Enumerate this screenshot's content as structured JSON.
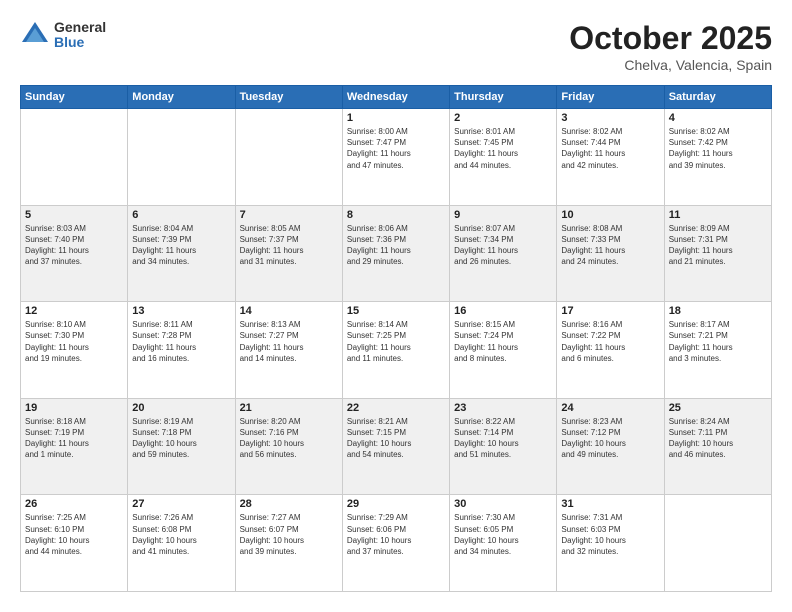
{
  "logo": {
    "general": "General",
    "blue": "Blue"
  },
  "title": "October 2025",
  "location": "Chelva, Valencia, Spain",
  "days_header": [
    "Sunday",
    "Monday",
    "Tuesday",
    "Wednesday",
    "Thursday",
    "Friday",
    "Saturday"
  ],
  "weeks": [
    [
      {
        "day": "",
        "info": ""
      },
      {
        "day": "",
        "info": ""
      },
      {
        "day": "",
        "info": ""
      },
      {
        "day": "1",
        "info": "Sunrise: 8:00 AM\nSunset: 7:47 PM\nDaylight: 11 hours\nand 47 minutes."
      },
      {
        "day": "2",
        "info": "Sunrise: 8:01 AM\nSunset: 7:45 PM\nDaylight: 11 hours\nand 44 minutes."
      },
      {
        "day": "3",
        "info": "Sunrise: 8:02 AM\nSunset: 7:44 PM\nDaylight: 11 hours\nand 42 minutes."
      },
      {
        "day": "4",
        "info": "Sunrise: 8:02 AM\nSunset: 7:42 PM\nDaylight: 11 hours\nand 39 minutes."
      }
    ],
    [
      {
        "day": "5",
        "info": "Sunrise: 8:03 AM\nSunset: 7:40 PM\nDaylight: 11 hours\nand 37 minutes."
      },
      {
        "day": "6",
        "info": "Sunrise: 8:04 AM\nSunset: 7:39 PM\nDaylight: 11 hours\nand 34 minutes."
      },
      {
        "day": "7",
        "info": "Sunrise: 8:05 AM\nSunset: 7:37 PM\nDaylight: 11 hours\nand 31 minutes."
      },
      {
        "day": "8",
        "info": "Sunrise: 8:06 AM\nSunset: 7:36 PM\nDaylight: 11 hours\nand 29 minutes."
      },
      {
        "day": "9",
        "info": "Sunrise: 8:07 AM\nSunset: 7:34 PM\nDaylight: 11 hours\nand 26 minutes."
      },
      {
        "day": "10",
        "info": "Sunrise: 8:08 AM\nSunset: 7:33 PM\nDaylight: 11 hours\nand 24 minutes."
      },
      {
        "day": "11",
        "info": "Sunrise: 8:09 AM\nSunset: 7:31 PM\nDaylight: 11 hours\nand 21 minutes."
      }
    ],
    [
      {
        "day": "12",
        "info": "Sunrise: 8:10 AM\nSunset: 7:30 PM\nDaylight: 11 hours\nand 19 minutes."
      },
      {
        "day": "13",
        "info": "Sunrise: 8:11 AM\nSunset: 7:28 PM\nDaylight: 11 hours\nand 16 minutes."
      },
      {
        "day": "14",
        "info": "Sunrise: 8:13 AM\nSunset: 7:27 PM\nDaylight: 11 hours\nand 14 minutes."
      },
      {
        "day": "15",
        "info": "Sunrise: 8:14 AM\nSunset: 7:25 PM\nDaylight: 11 hours\nand 11 minutes."
      },
      {
        "day": "16",
        "info": "Sunrise: 8:15 AM\nSunset: 7:24 PM\nDaylight: 11 hours\nand 8 minutes."
      },
      {
        "day": "17",
        "info": "Sunrise: 8:16 AM\nSunset: 7:22 PM\nDaylight: 11 hours\nand 6 minutes."
      },
      {
        "day": "18",
        "info": "Sunrise: 8:17 AM\nSunset: 7:21 PM\nDaylight: 11 hours\nand 3 minutes."
      }
    ],
    [
      {
        "day": "19",
        "info": "Sunrise: 8:18 AM\nSunset: 7:19 PM\nDaylight: 11 hours\nand 1 minute."
      },
      {
        "day": "20",
        "info": "Sunrise: 8:19 AM\nSunset: 7:18 PM\nDaylight: 10 hours\nand 59 minutes."
      },
      {
        "day": "21",
        "info": "Sunrise: 8:20 AM\nSunset: 7:16 PM\nDaylight: 10 hours\nand 56 minutes."
      },
      {
        "day": "22",
        "info": "Sunrise: 8:21 AM\nSunset: 7:15 PM\nDaylight: 10 hours\nand 54 minutes."
      },
      {
        "day": "23",
        "info": "Sunrise: 8:22 AM\nSunset: 7:14 PM\nDaylight: 10 hours\nand 51 minutes."
      },
      {
        "day": "24",
        "info": "Sunrise: 8:23 AM\nSunset: 7:12 PM\nDaylight: 10 hours\nand 49 minutes."
      },
      {
        "day": "25",
        "info": "Sunrise: 8:24 AM\nSunset: 7:11 PM\nDaylight: 10 hours\nand 46 minutes."
      }
    ],
    [
      {
        "day": "26",
        "info": "Sunrise: 7:25 AM\nSunset: 6:10 PM\nDaylight: 10 hours\nand 44 minutes."
      },
      {
        "day": "27",
        "info": "Sunrise: 7:26 AM\nSunset: 6:08 PM\nDaylight: 10 hours\nand 41 minutes."
      },
      {
        "day": "28",
        "info": "Sunrise: 7:27 AM\nSunset: 6:07 PM\nDaylight: 10 hours\nand 39 minutes."
      },
      {
        "day": "29",
        "info": "Sunrise: 7:29 AM\nSunset: 6:06 PM\nDaylight: 10 hours\nand 37 minutes."
      },
      {
        "day": "30",
        "info": "Sunrise: 7:30 AM\nSunset: 6:05 PM\nDaylight: 10 hours\nand 34 minutes."
      },
      {
        "day": "31",
        "info": "Sunrise: 7:31 AM\nSunset: 6:03 PM\nDaylight: 10 hours\nand 32 minutes."
      },
      {
        "day": "",
        "info": ""
      }
    ]
  ]
}
